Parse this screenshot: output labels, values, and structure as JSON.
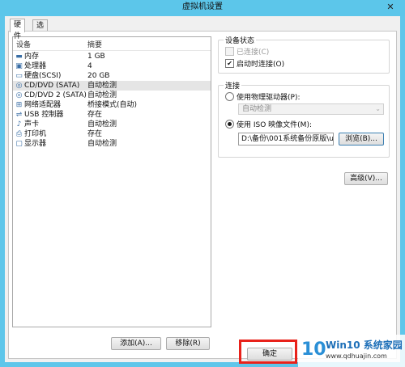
{
  "window": {
    "title": "虚拟机设置",
    "close_glyph": "✕"
  },
  "tabs": [
    {
      "label": "硬件"
    },
    {
      "label": "选项"
    }
  ],
  "device_list": {
    "headers": {
      "device": "设备",
      "summary": "摘要"
    },
    "rows": [
      {
        "icon": "memory-icon",
        "glyph": "▬",
        "name": "内存",
        "summary": "1 GB"
      },
      {
        "icon": "cpu-icon",
        "glyph": "▣",
        "name": "处理器",
        "summary": "4"
      },
      {
        "icon": "hard-disk-icon",
        "glyph": "▭",
        "name": "硬盘(SCSI)",
        "summary": "20 GB"
      },
      {
        "icon": "cd-dvd-icon",
        "glyph": "◎",
        "name": "CD/DVD (SATA)",
        "summary": "自动检测"
      },
      {
        "icon": "cd-dvd-icon",
        "glyph": "◎",
        "name": "CD/DVD 2 (SATA)",
        "summary": "自动检测"
      },
      {
        "icon": "network-adapter-icon",
        "glyph": "⊞",
        "name": "网络适配器",
        "summary": "桥接模式(自动)"
      },
      {
        "icon": "usb-icon",
        "glyph": "⇌",
        "name": "USB 控制器",
        "summary": "存在"
      },
      {
        "icon": "sound-card-icon",
        "glyph": "♪",
        "name": "声卡",
        "summary": "自动检测"
      },
      {
        "icon": "printer-icon",
        "glyph": "⎙",
        "name": "打印机",
        "summary": "存在"
      },
      {
        "icon": "display-icon",
        "glyph": "▢",
        "name": "显示器",
        "summary": "自动检测"
      }
    ],
    "selected_index": 3
  },
  "buttons": {
    "add": "添加(A)...",
    "remove": "移除(R)",
    "browse": "浏览(B)...",
    "advanced": "高级(V)...",
    "ok": "确定"
  },
  "device_status": {
    "title": "设备状态",
    "connected": {
      "label": "已连接(C)",
      "checked": false,
      "enabled": false
    },
    "connect_at_power_on": {
      "label": "启动时连接(O)",
      "checked": true,
      "check_glyph": "✔"
    }
  },
  "connection": {
    "title": "连接",
    "physical_drive": {
      "label": "使用物理驱动器(P):",
      "selected": false
    },
    "drive_select": {
      "value": "自动检测",
      "arrow": "⌄"
    },
    "iso_image": {
      "label": "使用 ISO 映像文件(M):",
      "selected": true
    },
    "iso_path": "D:\\备份\\001系统备份原版\\u"
  },
  "watermark": {
    "logo_text": "10",
    "title": "Win10 系统家园",
    "url": "www.qdhuajin.com"
  }
}
